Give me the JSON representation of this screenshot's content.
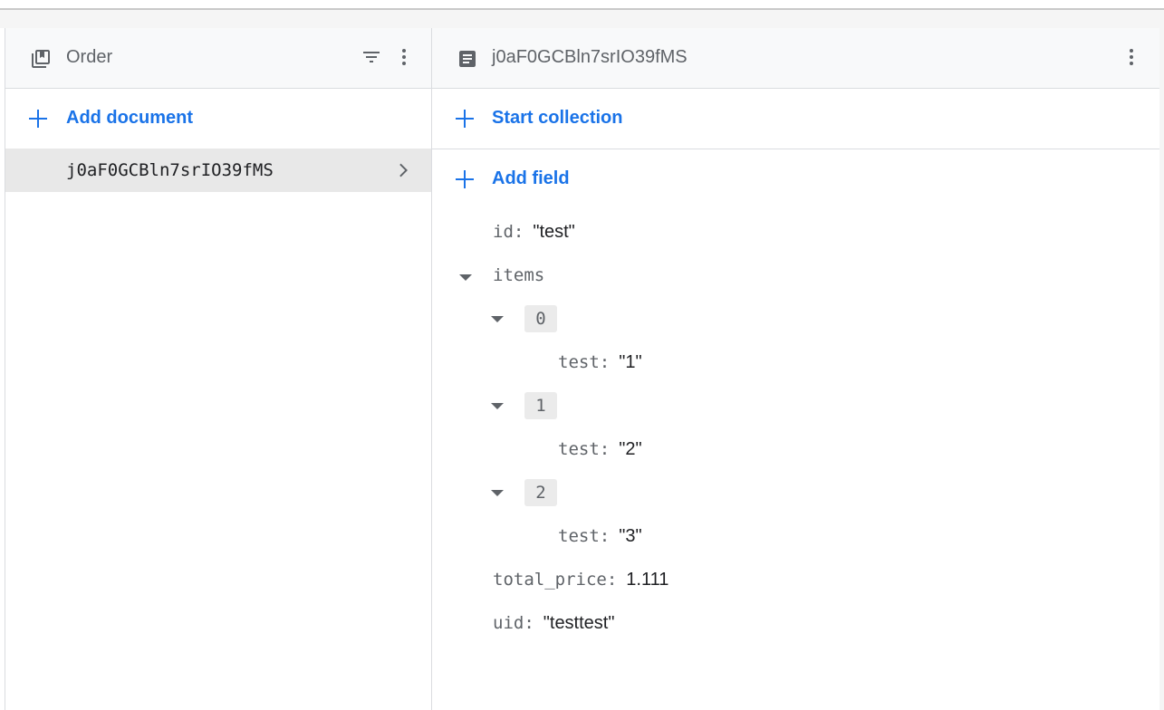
{
  "collection": {
    "title": "Order",
    "icon": "collection-icon",
    "add_document_label": "Add document",
    "documents": [
      {
        "id": "j0aF0GCBln7srIO39fMS"
      }
    ]
  },
  "document": {
    "title": "j0aF0GCBln7srIO39fMS",
    "icon": "document-icon",
    "start_collection_label": "Start collection",
    "add_field_label": "Add field",
    "fields": {
      "id": {
        "key": "id",
        "value": "\"test\""
      },
      "items": {
        "key": "items",
        "entries": [
          {
            "index": "0",
            "key": "test",
            "value": "\"1\""
          },
          {
            "index": "1",
            "key": "test",
            "value": "\"2\""
          },
          {
            "index": "2",
            "key": "test",
            "value": "\"3\""
          }
        ]
      },
      "total_price": {
        "key": "total_price",
        "value": "1.111"
      },
      "uid": {
        "key": "uid",
        "value": "\"testtest\""
      }
    }
  },
  "colors": {
    "accent": "#1a73e8",
    "selected_row": "#e8e8e8",
    "border": "#dadce0"
  }
}
